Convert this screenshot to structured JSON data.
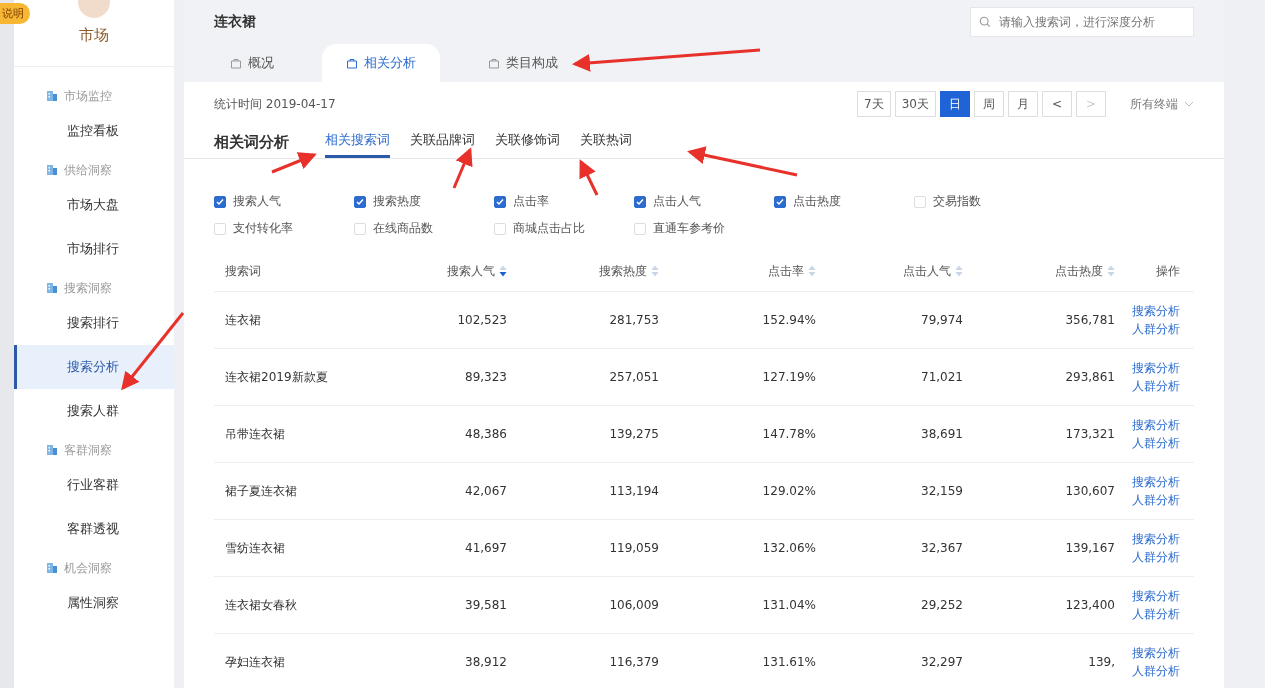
{
  "badge": "说明",
  "sidebar": {
    "title": "市场",
    "groups": [
      {
        "label": "市场监控",
        "items": [
          {
            "label": "监控看板",
            "selected": false
          }
        ]
      },
      {
        "label": "供给洞察",
        "items": [
          {
            "label": "市场大盘",
            "selected": false
          },
          {
            "label": "市场排行",
            "selected": false
          }
        ]
      },
      {
        "label": "搜索洞察",
        "items": [
          {
            "label": "搜索排行",
            "selected": false
          },
          {
            "label": "搜索分析",
            "selected": true
          },
          {
            "label": "搜索人群",
            "selected": false
          }
        ]
      },
      {
        "label": "客群洞察",
        "items": [
          {
            "label": "行业客群",
            "selected": false
          },
          {
            "label": "客群透视",
            "selected": false
          }
        ]
      },
      {
        "label": "机会洞察",
        "items": [
          {
            "label": "属性洞察",
            "selected": false
          }
        ]
      }
    ]
  },
  "header": {
    "title": "连衣裙",
    "search": {
      "placeholder": "请输入搜索词，进行深度分析"
    },
    "tabs": [
      {
        "label": "概况",
        "selected": false
      },
      {
        "label": "相关分析",
        "selected": true
      },
      {
        "label": "类目构成",
        "selected": false
      }
    ]
  },
  "toolbar": {
    "stat_time": "统计时间 2019-04-17",
    "periods": [
      {
        "label": "7天",
        "selected": false
      },
      {
        "label": "30天",
        "selected": false
      },
      {
        "label": "日",
        "selected": true
      },
      {
        "label": "周",
        "selected": false
      },
      {
        "label": "月",
        "selected": false
      }
    ],
    "prev": "<",
    "next": ">",
    "next_disabled": true,
    "terminal": "所有终端"
  },
  "section": {
    "title": "相关词分析",
    "tabs": [
      {
        "label": "相关搜索词",
        "selected": true
      },
      {
        "label": "关联品牌词",
        "selected": false
      },
      {
        "label": "关联修饰词",
        "selected": false
      },
      {
        "label": "关联热词",
        "selected": false
      }
    ]
  },
  "metrics": [
    {
      "label": "搜索人气",
      "checked": true
    },
    {
      "label": "搜索热度",
      "checked": true
    },
    {
      "label": "点击率",
      "checked": true
    },
    {
      "label": "点击人气",
      "checked": true
    },
    {
      "label": "点击热度",
      "checked": true
    },
    {
      "label": "交易指数",
      "checked": false
    },
    {
      "label": "支付转化率",
      "checked": false
    },
    {
      "label": "在线商品数",
      "checked": false
    },
    {
      "label": "商城点击占比",
      "checked": false
    },
    {
      "label": "直通车参考价",
      "checked": false
    }
  ],
  "table": {
    "columns": [
      {
        "label": "搜索词"
      },
      {
        "label": "搜索人气",
        "sorted": true
      },
      {
        "label": "搜索热度",
        "sorted": false
      },
      {
        "label": "点击率",
        "sorted": false
      },
      {
        "label": "点击人气",
        "sorted": false
      },
      {
        "label": "点击热度",
        "sorted": false
      },
      {
        "label": "操作"
      }
    ],
    "rows": [
      {
        "cells": [
          "连衣裙",
          "102,523",
          "281,753",
          "152.94%",
          "79,974",
          "356,781"
        ],
        "actions": [
          "搜索分析",
          "人群分析"
        ]
      },
      {
        "cells": [
          "连衣裙2019新款夏",
          "89,323",
          "257,051",
          "127.19%",
          "71,021",
          "293,861"
        ],
        "actions": [
          "搜索分析",
          "人群分析"
        ]
      },
      {
        "cells": [
          "吊带连衣裙",
          "48,386",
          "139,275",
          "147.78%",
          "38,691",
          "173,321"
        ],
        "actions": [
          "搜索分析",
          "人群分析"
        ]
      },
      {
        "cells": [
          "裙子夏连衣裙",
          "42,067",
          "113,194",
          "129.02%",
          "32,159",
          "130,607"
        ],
        "actions": [
          "搜索分析",
          "人群分析"
        ]
      },
      {
        "cells": [
          "雪纺连衣裙",
          "41,697",
          "119,059",
          "132.06%",
          "32,367",
          "139,167"
        ],
        "actions": [
          "搜索分析",
          "人群分析"
        ]
      },
      {
        "cells": [
          "连衣裙女春秋",
          "39,581",
          "106,009",
          "131.04%",
          "29,252",
          "123,400"
        ],
        "actions": [
          "搜索分析",
          "人群分析"
        ]
      },
      {
        "cells": [
          "孕妇连衣裙",
          "38,912",
          "116,379",
          "131.61%",
          "32,297",
          "139,"
        ],
        "actions": [
          "搜索分析",
          "人群分析"
        ]
      }
    ]
  }
}
